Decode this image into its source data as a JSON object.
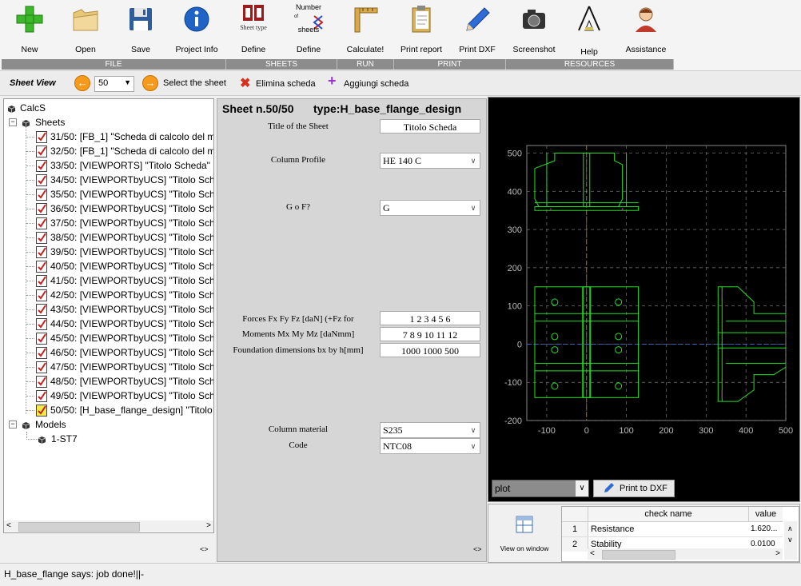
{
  "toolbar": {
    "buttons": [
      {
        "label": "New",
        "icon": "plus-icon"
      },
      {
        "label": "Open",
        "icon": "folder-icon"
      },
      {
        "label": "Save",
        "icon": "floppy-icon"
      },
      {
        "label": "Project Info",
        "icon": "info-icon"
      },
      {
        "label": "Define",
        "icon": "sheet-type-icon",
        "icon_text": "Sheet type"
      },
      {
        "label": "Define",
        "icon": "number-sheets-icon",
        "icon_text_top": "Number",
        "icon_text_mid": "of",
        "icon_text_bottom": "sheets"
      },
      {
        "label": "Calculate!",
        "icon": "ruler-icon"
      },
      {
        "label": "Print report",
        "icon": "clipboard-icon"
      },
      {
        "label": "Print DXF",
        "icon": "pencil-icon"
      },
      {
        "label": "Screenshot",
        "icon": "camera-icon"
      },
      {
        "label": "Help",
        "icon": "help-tent-icon"
      },
      {
        "label": "Assistance",
        "icon": "assistant-icon"
      }
    ],
    "groups": [
      "FILE",
      "SHEETS",
      "RUN",
      "PRINT",
      "RESOURCES"
    ]
  },
  "sheet_view": {
    "title": "Sheet View",
    "current": "50",
    "select_label": "Select the sheet",
    "delete_label": "Elimina scheda",
    "add_label": "Aggiungi scheda"
  },
  "tree": {
    "root": "CalcS",
    "sheets_label": "Sheets",
    "sheets": [
      "31/50: [FB_1] \"Scheda di calcolo del m",
      "32/50: [FB_1] \"Scheda di calcolo del m",
      "33/50: [VIEWPORTS] \"Titolo Scheda\"",
      "34/50: [VIEWPORTbyUCS] \"Titolo Sche",
      "35/50: [VIEWPORTbyUCS] \"Titolo Sche",
      "36/50: [VIEWPORTbyUCS] \"Titolo Sche",
      "37/50: [VIEWPORTbyUCS] \"Titolo Sche",
      "38/50: [VIEWPORTbyUCS] \"Titolo Sche",
      "39/50: [VIEWPORTbyUCS] \"Titolo Sche",
      "40/50: [VIEWPORTbyUCS] \"Titolo Sche",
      "41/50: [VIEWPORTbyUCS] \"Titolo Sche",
      "42/50: [VIEWPORTbyUCS] \"Titolo Sche",
      "43/50: [VIEWPORTbyUCS] \"Titolo Sche",
      "44/50: [VIEWPORTbyUCS] \"Titolo Sche",
      "45/50: [VIEWPORTbyUCS] \"Titolo Sche",
      "46/50: [VIEWPORTbyUCS] \"Titolo Sche",
      "47/50: [VIEWPORTbyUCS] \"Titolo Sche",
      "48/50: [VIEWPORTbyUCS] \"Titolo Sche",
      "49/50: [VIEWPORTbyUCS] \"Titolo Sche",
      "50/50: [H_base_flange_design] \"Titolo"
    ],
    "models_label": "Models",
    "models": [
      "1-ST7"
    ],
    "resize_glyph": "<>"
  },
  "form": {
    "header_sheet": "Sheet n.50/50",
    "header_type": "type:H_base_flange_design",
    "title_label": "Title of the Sheet",
    "title_value": "Titolo Scheda",
    "profile_label": "Column Profile",
    "profile_value": "HE 140 C",
    "gof_label": "G o F?",
    "gof_value": "G",
    "forces_label": "Forces Fx Fy Fz [daN] (+Fz for",
    "forces_value": "1 2 3 4 5 6",
    "moments_label": "Moments Mx My Mz [daNmm]",
    "moments_value": "7 8 9 10 11 12",
    "foundation_label": "Foundation dimensions bx by h[mm]",
    "foundation_value": "1000 1000 500",
    "material_label": "Column material",
    "material_value": "S235",
    "code_label": "Code",
    "code_value": "NTC08",
    "resize_glyph": "<>"
  },
  "plot": {
    "select_value": "plot",
    "print_button": "Print to DXF",
    "x_ticks": [
      "-100",
      "0",
      "100",
      "200",
      "300",
      "400",
      "500"
    ],
    "y_ticks": [
      "500",
      "400",
      "300",
      "200",
      "100",
      "0",
      "-100",
      "-200"
    ]
  },
  "checks": {
    "view_label": "View on window",
    "columns": [
      "check name",
      "value"
    ],
    "rows": [
      {
        "n": "1",
        "name": "Resistance",
        "value": "1.620..."
      },
      {
        "n": "2",
        "name": "Stability",
        "value": "0.0100"
      }
    ]
  },
  "status": {
    "text": "H_base_flange says: job done!||-"
  },
  "colors": {
    "accent_orange": "#f59a1b",
    "group_bar": "#8c8c8c",
    "plot_green": "#22e022",
    "plot_magenta": "#d020d0"
  }
}
